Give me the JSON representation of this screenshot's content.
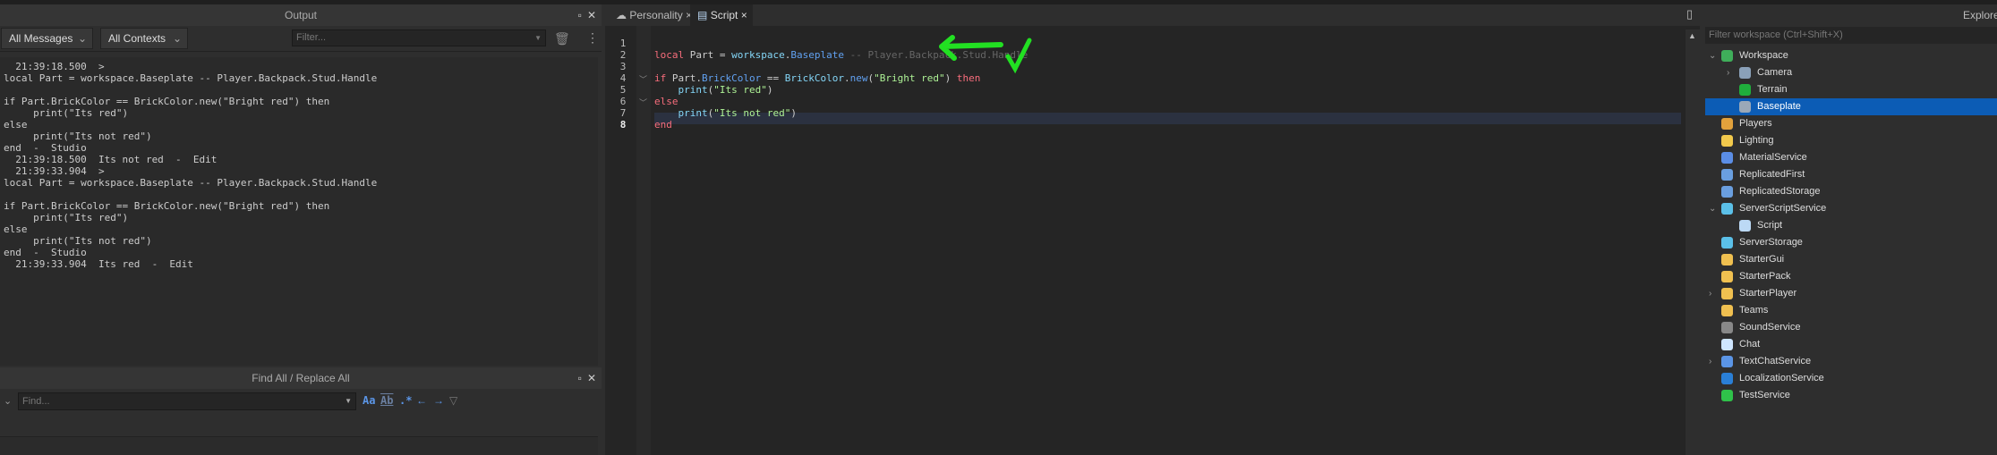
{
  "output": {
    "title": "Output",
    "filter_messages": "All Messages",
    "filter_contexts": "All Contexts",
    "filter_placeholder": "Filter...",
    "lines": [
      "  21:39:18.500  >",
      "local Part = workspace.Baseplate -- Player.Backpack.Stud.Handle",
      "",
      "if Part.BrickColor == BrickColor.new(\"Bright red\") then",
      "     print(\"Its red\")",
      "else",
      "     print(\"Its not red\")",
      "end  -  Studio",
      "  21:39:18.500  Its not red  -  Edit",
      "  21:39:33.904  >",
      "local Part = workspace.Baseplate -- Player.Backpack.Stud.Handle",
      "",
      "if Part.BrickColor == BrickColor.new(\"Bright red\") then",
      "     print(\"Its red\")",
      "else",
      "     print(\"Its not red\")",
      "end  -  Studio",
      "  21:39:33.904  Its red  -  Edit"
    ]
  },
  "find": {
    "title": "Find All / Replace All",
    "placeholder": "Find...",
    "match_case": "Aa",
    "whole_word": "Ab",
    "regex": ".*"
  },
  "editor": {
    "tabs": [
      {
        "label": "Personality",
        "close": "×"
      },
      {
        "label": "Script",
        "close": "×"
      }
    ],
    "line_numbers": [
      "1",
      "2",
      "3",
      "4",
      "5",
      "6",
      "7",
      "8"
    ]
  },
  "explorer": {
    "title": "Explorer",
    "filter_placeholder": "Filter workspace (Ctrl+Shift+X)",
    "items": [
      {
        "label": "Workspace",
        "color": "#3fae5a"
      },
      {
        "label": "Camera",
        "color": "#8aa0b8"
      },
      {
        "label": "Terrain",
        "color": "#1fae3c"
      },
      {
        "label": "Baseplate",
        "color": "#9aa8b8"
      },
      {
        "label": "Players",
        "color": "#e2a13c"
      },
      {
        "label": "Lighting",
        "color": "#f2c94c"
      },
      {
        "label": "MaterialService",
        "color": "#5b8ee6"
      },
      {
        "label": "ReplicatedFirst",
        "color": "#6a9fe0"
      },
      {
        "label": "ReplicatedStorage",
        "color": "#6a9fe0"
      },
      {
        "label": "ServerScriptService",
        "color": "#5bc0e8"
      },
      {
        "label": "Script",
        "color": "#bcd9f5"
      },
      {
        "label": "ServerStorage",
        "color": "#5bc0e8"
      },
      {
        "label": "StarterGui",
        "color": "#f0c050"
      },
      {
        "label": "StarterPack",
        "color": "#f0c050"
      },
      {
        "label": "StarterPlayer",
        "color": "#f0c050"
      },
      {
        "label": "Teams",
        "color": "#f0c050"
      },
      {
        "label": "SoundService",
        "color": "#888888"
      },
      {
        "label": "Chat",
        "color": "#cfe6ff"
      },
      {
        "label": "TextChatService",
        "color": "#5b95e6"
      },
      {
        "label": "LocalizationService",
        "color": "#2a7fd6"
      },
      {
        "label": "TestService",
        "color": "#2fc24a"
      }
    ]
  },
  "annotation_color": "#22e022"
}
